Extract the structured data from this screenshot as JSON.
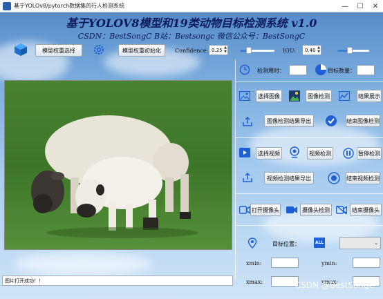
{
  "window": {
    "title": "基于YOLOv8/pytorch数据集的行人检测系统"
  },
  "header": {
    "title": "基于YOLOV8模型和19类动物目标检测系统 v1.0",
    "subtitle": "CSDN：BestSongC   B站：Bestsongc   微信公众号：BestSongC"
  },
  "toolbar": {
    "select_model_label": "模型权重选择",
    "init_model_label": "模型权重初始化",
    "confidence_label": "Confidence:",
    "confidence_value": "0.25",
    "confidence_level": 0.25,
    "iou_label": "IOU:",
    "iou_value": "0.40",
    "iou_level": 0.4
  },
  "stats": {
    "time_label": "检测用时：",
    "time_value": "",
    "count_label": "目标数量：",
    "count_value": ""
  },
  "image_section": {
    "select_label": "选择图像",
    "detect_label": "图像检测",
    "show_label": "结果展示",
    "export_label": "图像检测结果导出",
    "end_label": "结束图像检测"
  },
  "video_section": {
    "select_label": "选择视频",
    "detect_label": "视频检测",
    "pause_label": "暂停检测",
    "export_label": "视频检测结果导出",
    "end_label": "结束视频检测"
  },
  "camera_section": {
    "open_label": "打开摄像头",
    "detect_label": "摄像头检测",
    "end_label": "结束摄像头"
  },
  "target": {
    "position_label": "目标位置：",
    "all_badge": "ALL",
    "xmin_label": "xmin:",
    "ymin_label": "ymin:",
    "xmax_label": "xmax:",
    "ymax_label": "ymax:",
    "xmin_value": "",
    "ymin_value": "",
    "xmax_value": "",
    "ymax_value": ""
  },
  "status": {
    "message": "图片打开成功！！"
  },
  "watermark": "CSDN @BestSongC",
  "colors": {
    "accent": "#1e5fd6",
    "title": "#0a1a5c",
    "grass": "#3f7a2a"
  }
}
